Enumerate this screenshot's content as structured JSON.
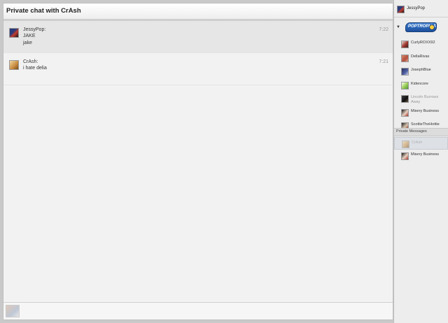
{
  "chat": {
    "title": "Private chat with CrAsh",
    "messages": [
      {
        "name": "JessyPop:",
        "lines": [
          "JAKE",
          "jake"
        ],
        "time": "7:22",
        "avatar": "jessy-avatar"
      },
      {
        "name": "CrAsh:",
        "lines": [
          "i hate delia"
        ],
        "time": "7:21",
        "avatar": "crash-avatar"
      }
    ],
    "input": {
      "value": "",
      "placeholder": ""
    }
  },
  "sidebar": {
    "current_user": "JessyPop",
    "room_logo_text": "POPTROPICA",
    "users": [
      {
        "name": "CurlyROXX92",
        "away": false
      },
      {
        "name": "DellaRivas",
        "away": false
      },
      {
        "name": "JosephBlue",
        "away": false
      },
      {
        "name": "Kidencore",
        "away": false
      },
      {
        "name": "Lincoln Burrows Away",
        "away": true
      },
      {
        "name": "Misery Business",
        "away": false
      },
      {
        "name": "ScottieTheHottie",
        "away": false
      }
    ],
    "private_messages_label": "Private Messages",
    "private_messages": [
      {
        "name": "CrAsh",
        "active": true
      },
      {
        "name": "Misery Business",
        "active": false
      }
    ]
  },
  "colors": {
    "background": "#f2f2f2",
    "frame": "#c9c9c9",
    "highlight_row": "#e6e6e6",
    "logo_blue": "#2b66b8"
  }
}
